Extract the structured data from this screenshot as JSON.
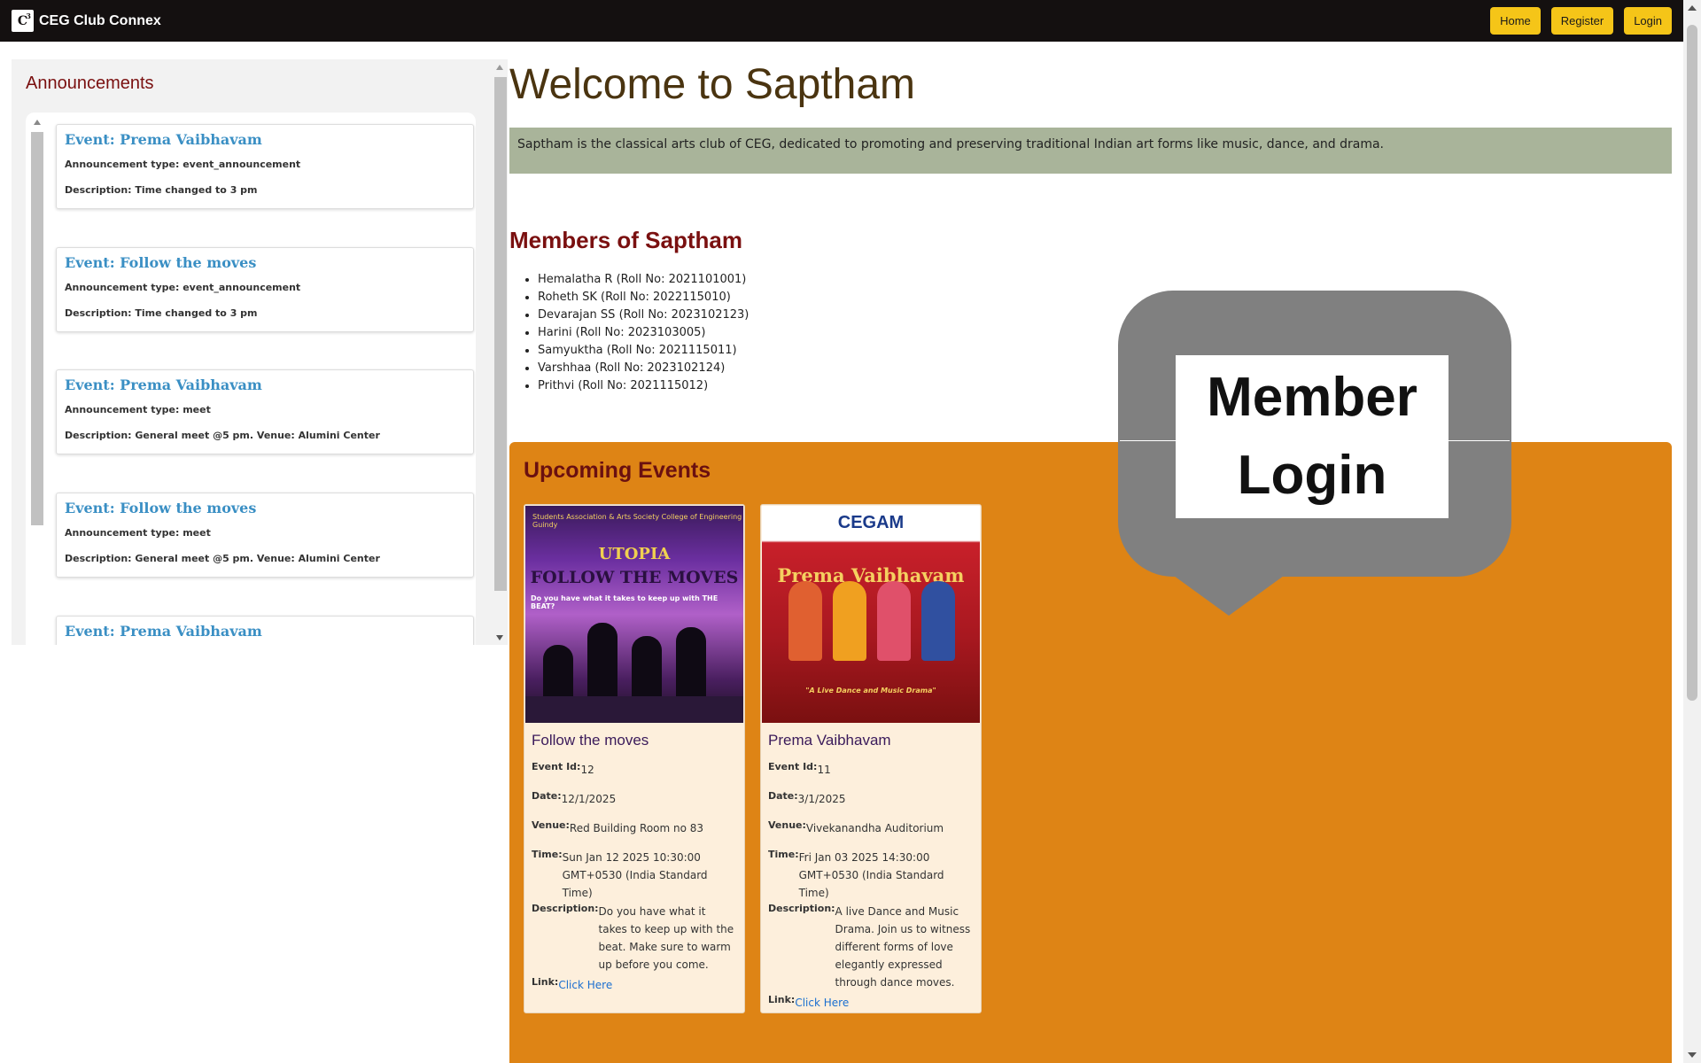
{
  "navbar": {
    "brand_name": "CEG Club Connex",
    "logo_glyph": "C",
    "logo_sup": "3",
    "buttons": [
      "Home",
      "Register",
      "Login"
    ],
    "bg_color": "#141010",
    "button_color": "#f5c518"
  },
  "announcements": {
    "title": "Announcements",
    "items": [
      {
        "title": "Event: Prema Vaibhavam",
        "type": "Announcement type: event_announcement",
        "description": "Description: Time changed to 3 pm"
      },
      {
        "title": "Event: Follow the moves",
        "type": "Announcement type: event_announcement",
        "description": "Description: Time changed to 3 pm"
      },
      {
        "title": "Event: Prema Vaibhavam",
        "type": "Announcement type: meet",
        "description": "Description: General meet @5 pm. Venue: Alumini Center"
      },
      {
        "title": "Event: Follow the moves",
        "type": "Announcement type: meet",
        "description": "Description: General meet @5 pm. Venue: Alumini Center"
      },
      {
        "title": "Event: Prema Vaibhavam",
        "type": "",
        "description": ""
      }
    ]
  },
  "main": {
    "welcome": "Welcome to Saptham",
    "about": "Saptham is the classical arts club of CEG, dedicated to promoting and preserving traditional Indian art forms like music, dance, and drama.",
    "members_title": "Members of Saptham",
    "members": [
      "Hemalatha R (Roll No: 2021101001)",
      "Roheth SK (Roll No: 2022115010)",
      "Devarajan SS (Roll No: 2023102123)",
      "Harini (Roll No: 2023103005)",
      "Samyuktha (Roll No: 2021115011)",
      "Varshhaa (Roll No: 2023102124)",
      "Prithvi (Roll No: 2021115012)"
    ]
  },
  "events": {
    "title": "Upcoming Events",
    "labels": {
      "id": "Event Id:",
      "date": "Date:",
      "venue": "Venue:",
      "time": "Time:",
      "description": "Description:",
      "link": "Link:"
    },
    "items": [
      {
        "name": "Follow the moves",
        "id": "12",
        "date": "12/1/2025",
        "venue": "Red Building Room no 83",
        "time": "Sun Jan 12 2025 10:30:00 GMT+0530 (India Standard Time)",
        "description": "Do you have what it takes to keep up with the beat. Make sure to warm up before you come.",
        "link_text": "Click Here",
        "poster": {
          "top": "Students Association & Arts Society College of Engineering Guindy",
          "brand": "UTOPIA",
          "headline": "FOLLOW THE MOVES",
          "tagline": "Do you have what it takes to keep up with THE BEAT?"
        }
      },
      {
        "name": "Prema Vaibhavam",
        "id": "11",
        "date": "3/1/2025",
        "venue": "Vivekanandha Auditorium",
        "time": "Fri Jan 03 2025 14:30:00 GMT+0530 (India Standard Time)",
        "description": "A live Dance and Music Drama. Join us to witness different forms of love elegantly expressed through dance moves.",
        "link_text": "Click Here",
        "poster": {
          "top": "CEGAM",
          "headline": "Prema Vaibhavam",
          "tagline": "\"A Live Dance and Music Drama\""
        }
      }
    ]
  },
  "member_login": {
    "line1": "Member",
    "line2": "Login"
  }
}
